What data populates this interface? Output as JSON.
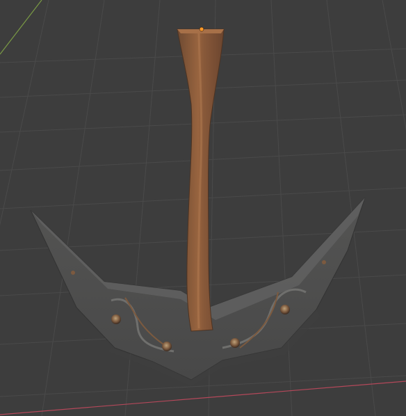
{
  "viewport": {
    "background": "#3d3d3d",
    "grid_color": "#4a4a4a",
    "x_axis_color": "#b4485a",
    "y_axis_color": "#7a9a45"
  },
  "scene": {
    "object": "pickaxe",
    "handle_color": "#8a5a3c",
    "head_color": "#5a5a59",
    "rivet_color": "#8a6a55",
    "origin_color": "#ff9a2a"
  }
}
